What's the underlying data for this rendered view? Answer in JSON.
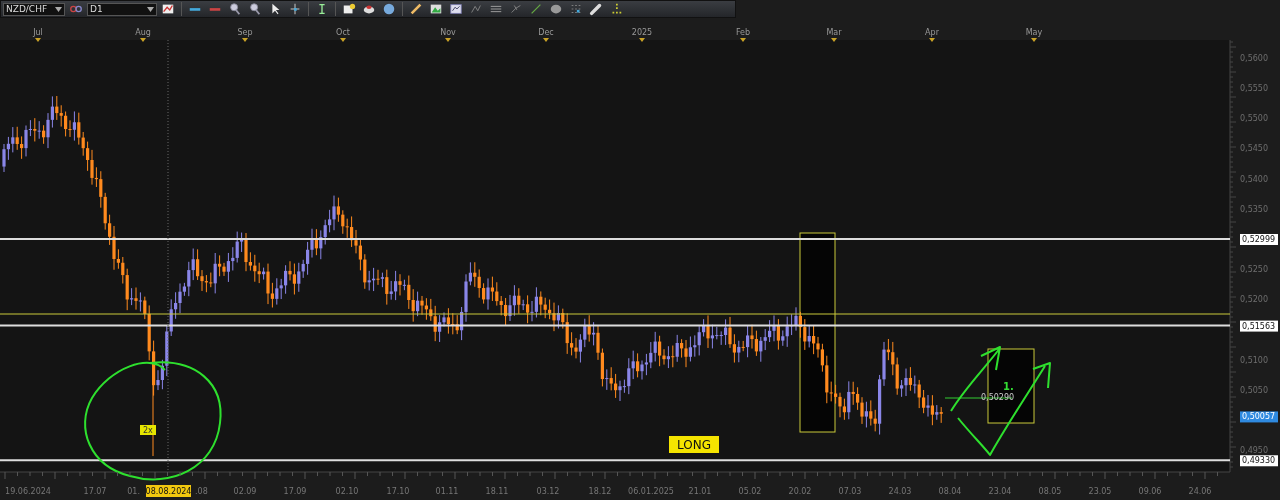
{
  "toolbar": {
    "symbol": "NZD/CHF",
    "timeframe": "D1"
  },
  "months": [
    "Jul",
    "Aug",
    "Sep",
    "Oct",
    "Nov",
    "Dec",
    "2025",
    "Feb",
    "Mar",
    "Apr",
    "May"
  ],
  "price_axis": [
    "0,5600",
    "0,5550",
    "0,5500",
    "0,5450",
    "0,5400",
    "0,5350",
    "0,5250",
    "0,5200",
    "0,5100",
    "0,5050",
    "0,4950"
  ],
  "levels": [
    {
      "kind": "line",
      "label": "0,52999"
    },
    {
      "kind": "line",
      "label": "0,51563"
    },
    {
      "kind": "current",
      "label": "0,50057"
    },
    {
      "kind": "line",
      "label": "0,49330"
    }
  ],
  "dates": [
    "19.06.2024",
    "17.07",
    "01.",
    ".08",
    "02.09",
    "17.09",
    "02.10",
    "17.10",
    "01.11",
    "18.11",
    "03.12",
    "18.12",
    "06.01.2025",
    "21.01",
    "05.02",
    "20.02",
    "07.03",
    "24.03",
    "08.04",
    "23.04",
    "08.05",
    "23.05",
    "09.06",
    "24.06"
  ],
  "cursor_date": "08.08.2024",
  "annotations": {
    "spike_label": "2x",
    "long_label": "LONG",
    "target_price": "0,50290",
    "handwritten_mark": "1."
  }
}
